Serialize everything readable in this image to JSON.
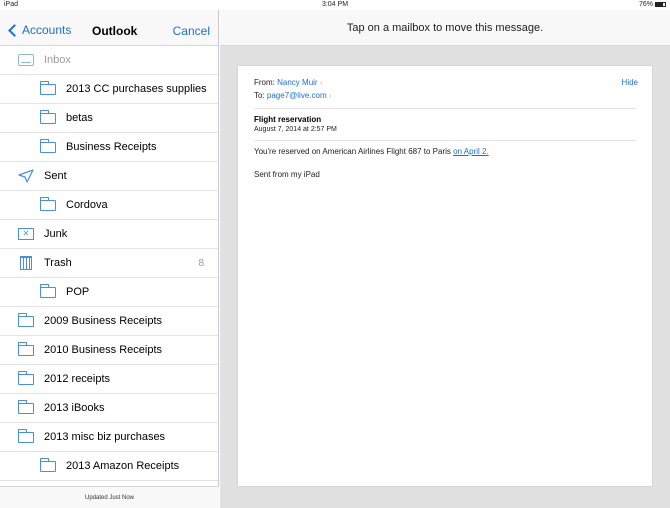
{
  "status_bar": {
    "carrier": "iPad",
    "time": "3:04 PM",
    "battery": "76%"
  },
  "sidebar": {
    "back_label": "Accounts",
    "title": "Outlook",
    "cancel_label": "Cancel",
    "folders": [
      {
        "label": "Inbox",
        "icon": "inbox-icon",
        "level": 0,
        "disabled": true
      },
      {
        "label": "2013 CC purchases supplies",
        "icon": "folder-icon",
        "level": 1
      },
      {
        "label": "betas",
        "icon": "folder-icon",
        "level": 1
      },
      {
        "label": "Business Receipts",
        "icon": "folder-icon",
        "level": 1
      },
      {
        "label": "Sent",
        "icon": "sent-icon",
        "level": 0
      },
      {
        "label": "Cordova",
        "icon": "folder-icon",
        "level": 1
      },
      {
        "label": "Junk",
        "icon": "junk-icon",
        "level": 0
      },
      {
        "label": "Trash",
        "icon": "trash-icon",
        "level": 0,
        "count": "8"
      },
      {
        "label": "POP",
        "icon": "folder-icon",
        "level": 1
      },
      {
        "label": "2009 Business Receipts",
        "icon": "folder-icon",
        "level": 0
      },
      {
        "label": "2010 Business Receipts",
        "icon": "folder-icon",
        "level": 0
      },
      {
        "label": "2012 receipts",
        "icon": "folder-icon",
        "level": 0
      },
      {
        "label": "2013 iBooks",
        "icon": "folder-icon",
        "level": 0
      },
      {
        "label": "2013 misc biz purchases",
        "icon": "folder-icon",
        "level": 0
      },
      {
        "label": "2013 Amazon Receipts",
        "icon": "folder-icon",
        "level": 1
      }
    ],
    "footer": "Updated Just Now"
  },
  "main": {
    "prompt": "Tap on a mailbox to move this message.",
    "message": {
      "from_label": "From:",
      "from_name": "Nancy Muir",
      "to_label": "To:",
      "to_address": "page7@live.com",
      "hide_label": "Hide",
      "subject": "Flight reservation",
      "date": "August 7, 2014 at 2:57 PM",
      "body_prefix": "You're reserved on American Airlines Flight 687 to Paris ",
      "body_link": "on April 2.",
      "signature": "Sent from my iPad"
    }
  },
  "colors": {
    "accent": "#1f6fd1",
    "folder_icon": "#4a90d9",
    "main_bg": "#e1e1e1"
  }
}
